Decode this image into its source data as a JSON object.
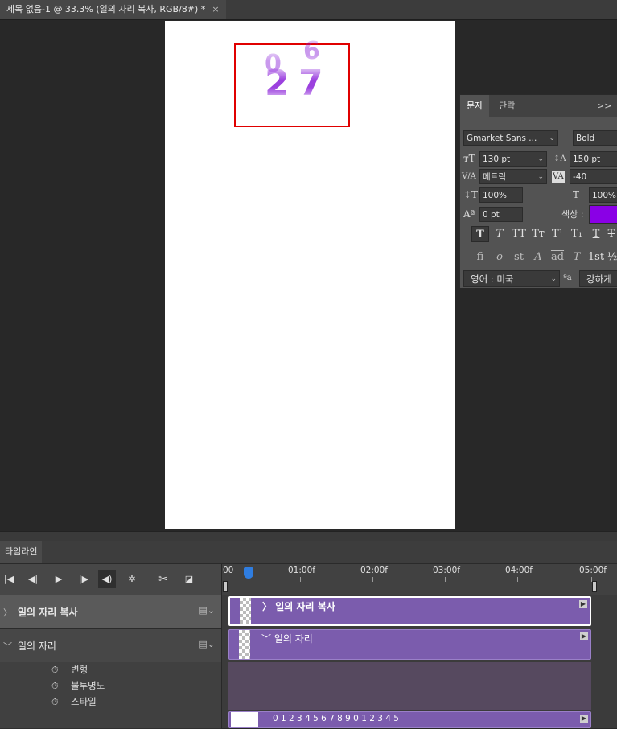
{
  "document_tab": {
    "title": "제목 없음-1 @ 33.3% (일의 자리 복사, RGB/8#) *",
    "close_glyph": "×"
  },
  "canvas": {
    "glyph_tens": "2",
    "glyph_ones": "7",
    "glyph_ghost_top_left": "0",
    "glyph_ghost_top_right": "6",
    "text_color": "#8a1fd9",
    "selection_color": "#e00000"
  },
  "character_panel": {
    "tabs": [
      "문자",
      "단락"
    ],
    "collapse_glyph": ">>",
    "font_family": "Gmarket Sans ...",
    "font_style": "Bold",
    "font_size": "130 pt",
    "leading": "150 pt",
    "kerning_label": "V/A",
    "kerning": "메트릭",
    "tracking": "-40",
    "vertical_scale": "100%",
    "horizontal_scale": "100%",
    "baseline_shift": "0 pt",
    "color_label": "색상 :",
    "color_value": "#8a00e6",
    "type_buttons": [
      "T",
      "T",
      "TT",
      "Tт",
      "T¹",
      "T₁",
      "T",
      "T"
    ],
    "opentype_buttons": [
      "fi",
      "o",
      "st",
      "A",
      "ad",
      "T",
      "1st",
      "½"
    ],
    "language": "영어 : 미국",
    "aa_icon": "ªa",
    "antialias": "강하게"
  },
  "timeline": {
    "panel_tab": "타임라인",
    "controls": [
      "first-frame",
      "prev-frame",
      "play",
      "next-frame",
      "audio",
      "settings",
      "split",
      "transition"
    ],
    "ruler_labels": [
      "00",
      "01:00f",
      "02:00f",
      "03:00f",
      "04:00f",
      "05:00f"
    ],
    "layers": [
      {
        "name": "일의 자리 복사",
        "expanded": false,
        "clip_label": "일의 자리 복사"
      },
      {
        "name": "일의 자리",
        "expanded": true,
        "clip_label": "일의 자리"
      }
    ],
    "properties": [
      "변형",
      "불투명도",
      "스타일"
    ],
    "bottom_clip_text": "0 1 2 3 4 5 6 7 8 9 0 1 2 3 4 5",
    "clip_color": "#7b5cad",
    "playhead_color": "#e03030"
  }
}
